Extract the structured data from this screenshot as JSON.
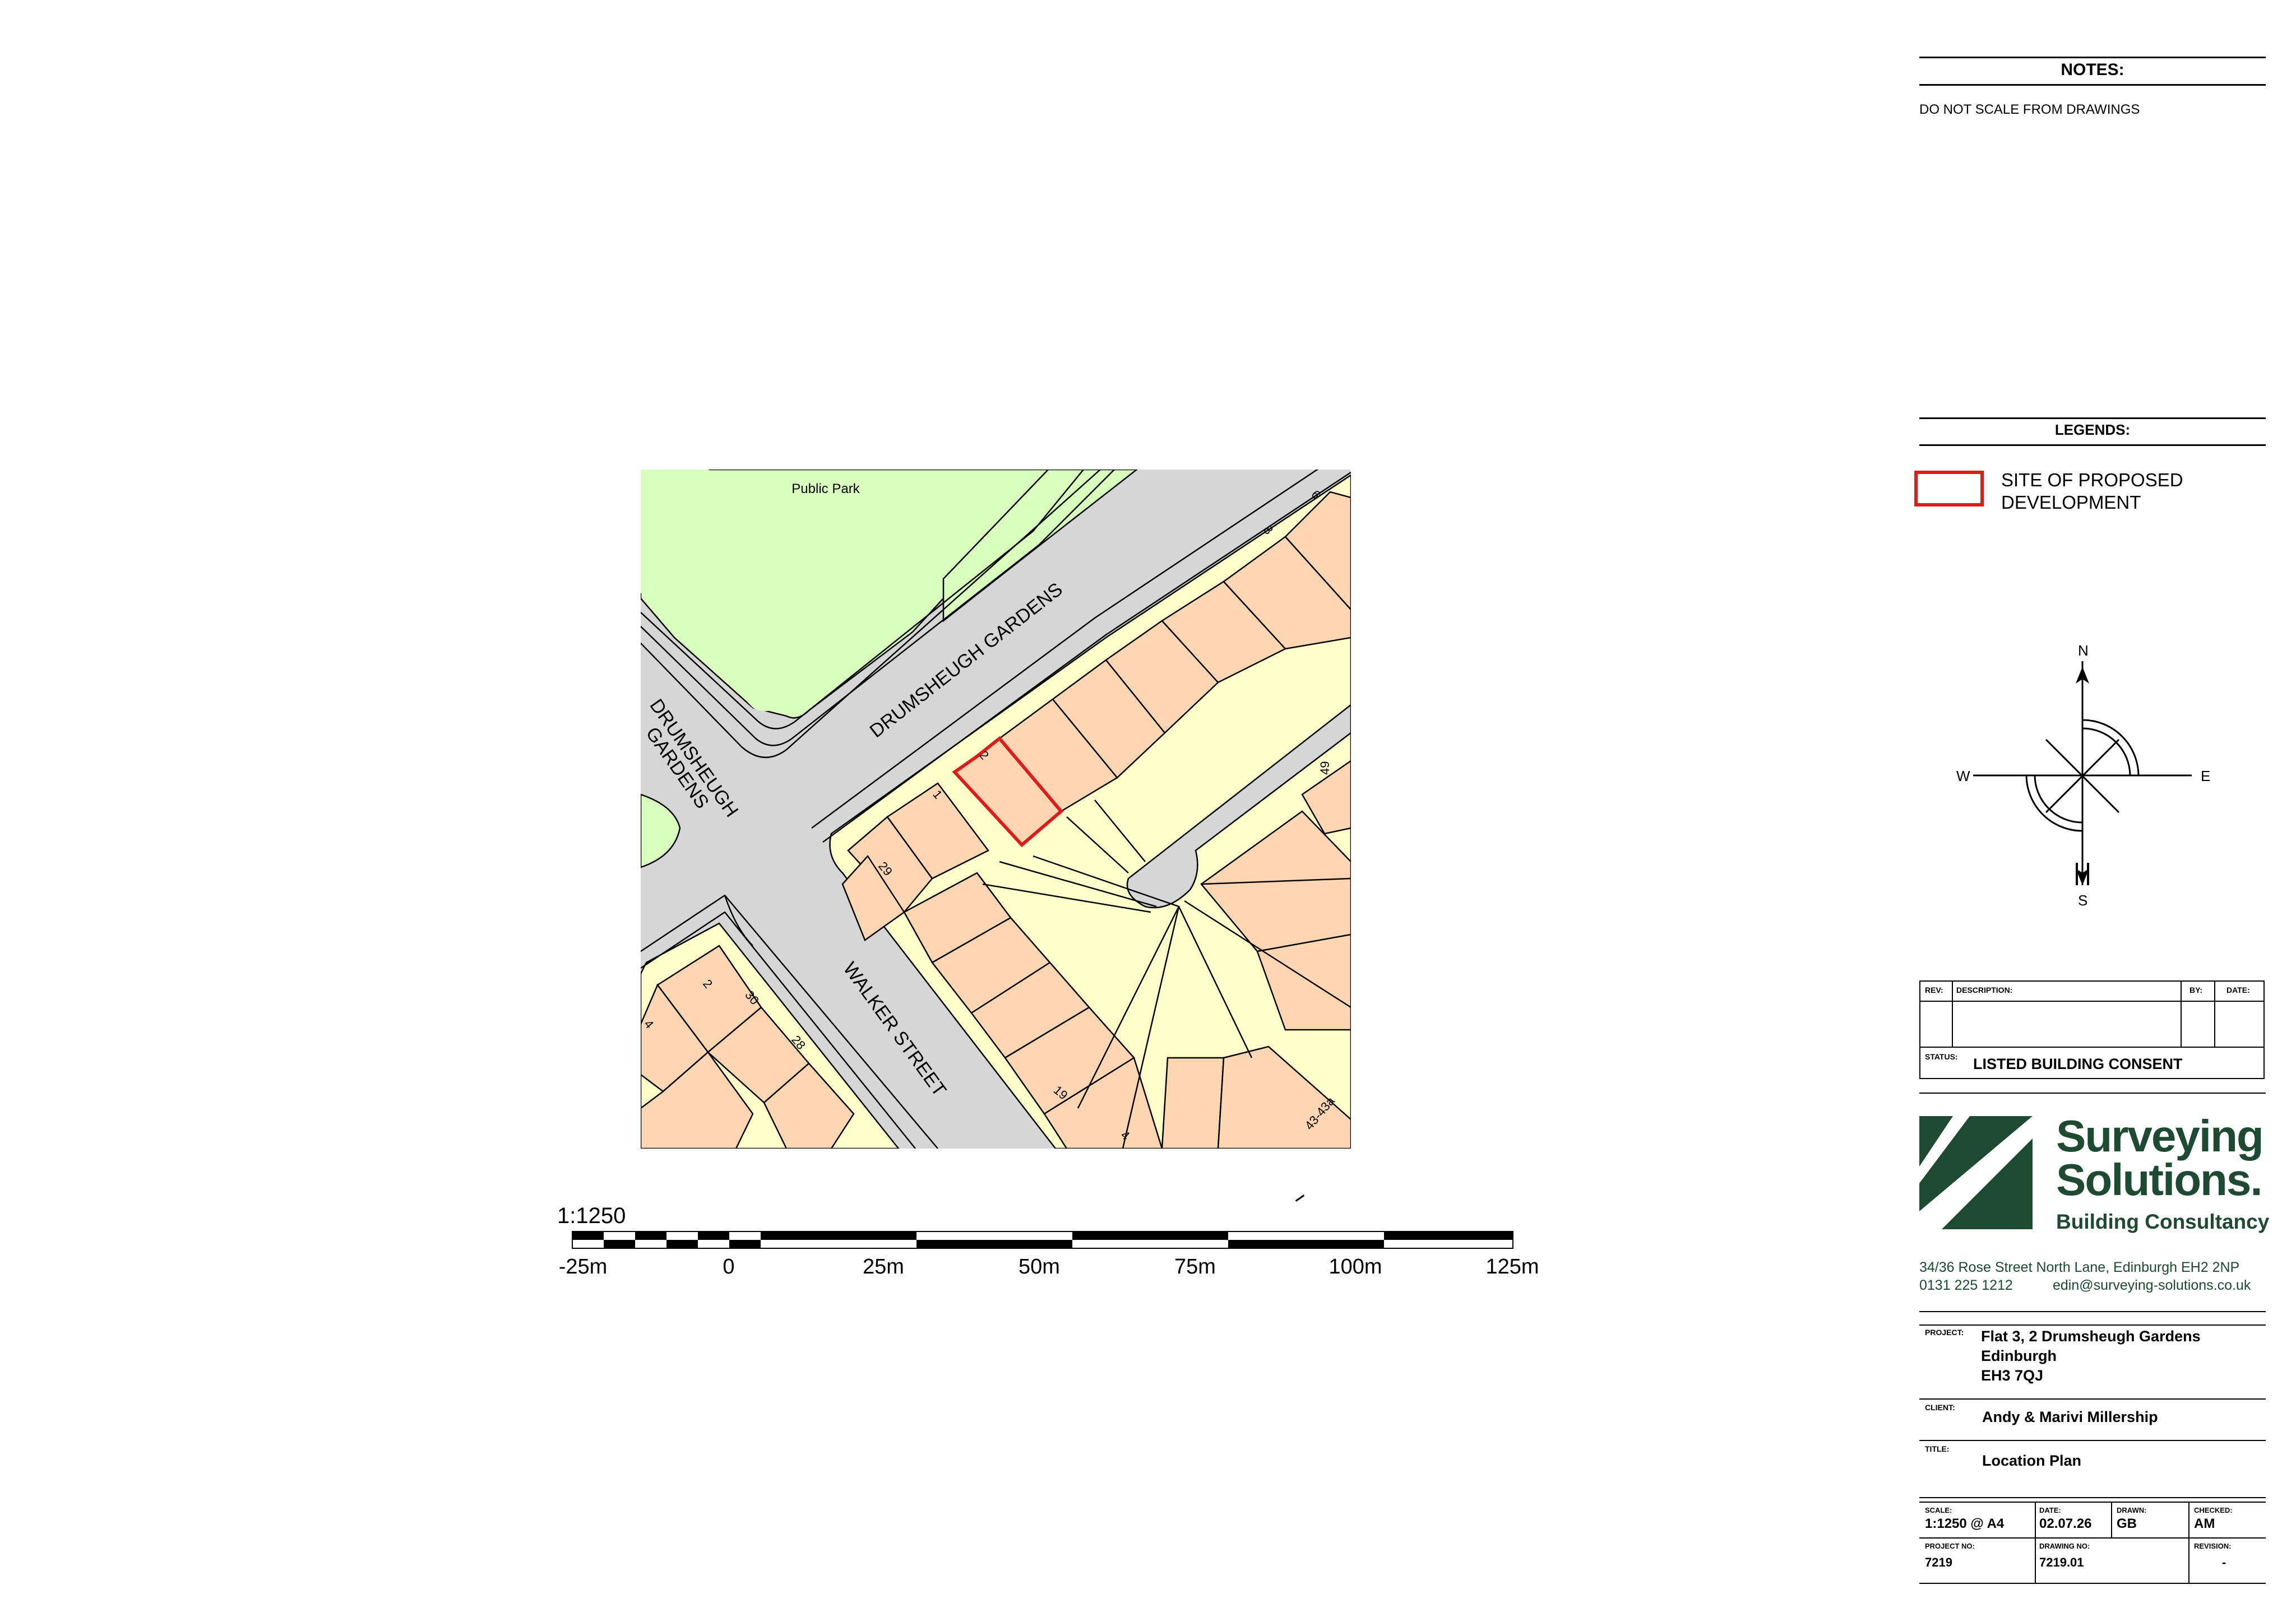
{
  "notes": {
    "title": "NOTES:",
    "text": "DO NOT SCALE FROM DRAWINGS"
  },
  "legends": {
    "title": "LEGENDS:",
    "site_label_1": "SITE OF PROPOSED",
    "site_label_2": "DEVELOPMENT",
    "site_color": "#dd1c1c"
  },
  "compass": {
    "n": "N",
    "e": "E",
    "s": "S",
    "w": "W"
  },
  "map": {
    "labels": {
      "park": "Public Park",
      "drumsheugh_gardens_1": "DRUMSHEUGH GARDENS",
      "drumsheugh_gardens_2a": "DRUMSHEUGH",
      "drumsheugh_gardens_2b": "GARDENS",
      "walker_street": "WALKER STREET"
    },
    "house_numbers": [
      "6",
      "8",
      "2",
      "1",
      "29",
      "49",
      "2",
      "30",
      "28",
      "4",
      "19",
      "4",
      "43-43a"
    ],
    "colors": {
      "park": "#d9ffbf",
      "road": "#d6d6d6",
      "building": "#fcd6b2",
      "yard": "#ffffcc",
      "site": "#dd1c1c"
    }
  },
  "scale": {
    "ratio": "1:1250",
    "ticks": [
      "-25m",
      "0",
      "25m",
      "50m",
      "75m",
      "100m",
      "125m"
    ]
  },
  "revisions": {
    "headers": {
      "rev": "REV:",
      "description": "DESCRIPTION:",
      "by": "BY:",
      "date": "DATE:"
    },
    "status_label": "STATUS:",
    "status_value": "LISTED BUILDING CONSENT"
  },
  "company": {
    "name_1": "Surveying",
    "name_2": "Solutions.",
    "tagline": "Building Consultancy",
    "address": "34/36 Rose Street North Lane, Edinburgh  EH2 2NP",
    "phone": "0131 225 1212",
    "email": "edin@surveying-solutions.co.uk",
    "brand_color": "#1e4a32"
  },
  "project": {
    "label": "PROJECT:",
    "line1": "Flat 3, 2 Drumsheugh Gardens",
    "line2": "Edinburgh",
    "line3": "EH3 7QJ"
  },
  "client": {
    "label": "CLIENT:",
    "value": "Andy & Marivi Millership"
  },
  "title": {
    "label": "TITLE:",
    "value": "Location Plan"
  },
  "details": {
    "scale_label": "SCALE:",
    "scale_value": "1:1250 @ A4",
    "date_label": "DATE:",
    "date_value": "02.07.26",
    "drawn_label": "DRAWN:",
    "drawn_value": "GB",
    "checked_label": "CHECKED:",
    "checked_value": "AM",
    "project_no_label": "PROJECT NO:",
    "project_no_value": "7219",
    "drawing_no_label": "DRAWING NO:",
    "drawing_no_value": "7219.01",
    "revision_label": "REVISION:",
    "revision_value": "-"
  }
}
